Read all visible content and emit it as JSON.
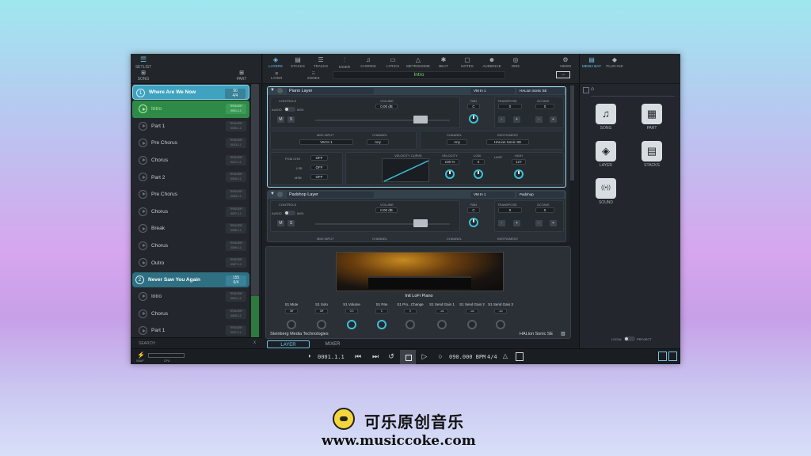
{
  "left_toolbar": {
    "setlist_label": "SETLIST",
    "song_label": "SONG",
    "part_label": "PART"
  },
  "setlist": [
    {
      "type": "song",
      "number": "1",
      "name": "Where Are We Now",
      "trigger_top": "90",
      "trigger_bottom": "4/4"
    },
    {
      "type": "part",
      "name": "Intro",
      "trigger_top": "TRIGGER",
      "trigger_bottom": "0001.1.1",
      "active": true
    },
    {
      "type": "part",
      "name": "Part 1",
      "trigger_top": "TRIGGER",
      "trigger_bottom": "0005.1.1"
    },
    {
      "type": "part",
      "name": "Pre Chorus",
      "trigger_top": "TRIGGER",
      "trigger_bottom": "0013.1.1"
    },
    {
      "type": "part",
      "name": "Chorus",
      "trigger_top": "TRIGGER",
      "trigger_bottom": "0017.1.1"
    },
    {
      "type": "part",
      "name": "Part 2",
      "trigger_top": "TRIGGER",
      "trigger_bottom": "0025.1.1"
    },
    {
      "type": "part",
      "name": "Pre Chorus",
      "trigger_top": "TRIGGER",
      "trigger_bottom": "0033.1.1"
    },
    {
      "type": "part",
      "name": "Chorus",
      "trigger_top": "TRIGGER",
      "trigger_bottom": "0037.1.1"
    },
    {
      "type": "part",
      "name": "Break",
      "trigger_top": "TRIGGER",
      "trigger_bottom": "0045.1.1"
    },
    {
      "type": "part",
      "name": "Chorus",
      "trigger_top": "TRIGGER",
      "trigger_bottom": "0049.1.1"
    },
    {
      "type": "part",
      "name": "Outro",
      "trigger_top": "TRIGGER",
      "trigger_bottom": "0057.1.1"
    },
    {
      "type": "song",
      "number": "2",
      "name": "Never Saw You Again",
      "trigger_top": "155",
      "trigger_bottom": "6/4"
    },
    {
      "type": "part",
      "name": "Intro",
      "trigger_top": "TRIGGER",
      "trigger_bottom": "0001.1.1"
    },
    {
      "type": "part",
      "name": "Chorus",
      "trigger_top": "TRIGGER",
      "trigger_bottom": "0009.1.1"
    },
    {
      "type": "part",
      "name": "Part 1",
      "trigger_top": "TRIGGER",
      "trigger_bottom": "0017.1.1"
    }
  ],
  "search_label": "SEARCH",
  "toolbar": {
    "tools": [
      {
        "label": "LAYERS",
        "icon": "layers-icon",
        "glyph": "◈"
      },
      {
        "label": "STACKS",
        "icon": "stacks-icon",
        "glyph": "▤"
      },
      {
        "label": "TRACKS",
        "icon": "tracks-icon",
        "glyph": "☰"
      },
      {
        "label": "MIXER",
        "icon": "mixer-icon",
        "glyph": "⫶"
      },
      {
        "label": "CHORDS",
        "icon": "chords-icon",
        "glyph": "♫"
      },
      {
        "label": "LYRICS",
        "icon": "lyrics-icon",
        "glyph": "▭"
      },
      {
        "label": "METRONOME",
        "icon": "metronome-icon",
        "glyph": "△"
      },
      {
        "label": "BEAT",
        "icon": "beat-icon",
        "glyph": "✱"
      },
      {
        "label": "NOTES",
        "icon": "notes-icon",
        "glyph": "▢"
      },
      {
        "label": "AUDIENCE",
        "icon": "audience-icon",
        "glyph": "☻"
      },
      {
        "label": "DMX",
        "icon": "dmx-icon",
        "glyph": "◎"
      }
    ],
    "views_label": "VIEWS",
    "layer_label": "LAYER",
    "zones_label": "ZONES",
    "current_part": "Intro"
  },
  "layers": [
    {
      "name": "Piano Layer",
      "midi_in": "VM In 1",
      "instrument": "HALion Sonic SE",
      "controls_label": "CONTROLS",
      "audio_label": "AUDIO",
      "midi_label": "MIDI",
      "volume_label": "VOLUME",
      "volume": "0.00 dB",
      "pan_label": "PAN",
      "pan": "C",
      "transpose_label": "TRANSPOSE",
      "transpose": "0",
      "octave_label": "OCTAVE",
      "octave": "0",
      "m_label": "M",
      "s_label": "S",
      "midi_input_label": "MIDI INPUT",
      "channel_label": "CHANNEL",
      "midi_input_value": "VM In 1",
      "channel_value": "Any",
      "channel2_label": "CHANNEL",
      "instrument_label": "INSTRUMENT",
      "channel2_value": "Any",
      "instrument_value": "HALion Sonic SE",
      "pgm_label": "PGM CHG",
      "pgm_value": "OFF",
      "lsb_label": "LSB",
      "lsb_value": "OFF",
      "msb_label": "MSB",
      "msb_value": "OFF",
      "velocity_curve_label": "VELOCITY CURVE",
      "velocity_label": "VELOCITY",
      "velocity_value": "100 %",
      "low_label": "LOW",
      "low_value": "0",
      "limit_label": "LIMIT",
      "high_label": "HIGH",
      "high_value": "127"
    },
    {
      "name": "Padshop Layer",
      "midi_in": "VM In 1",
      "instrument": "Padshop",
      "controls_label": "CONTROLS",
      "audio_label": "AUDIO",
      "midi_label": "MIDI",
      "volume_label": "VOLUME",
      "volume": "0.00 dB",
      "pan_label": "PAN",
      "pan": "C",
      "transpose_label": "TRANSPOSE",
      "transpose": "0",
      "octave_label": "OCTAVE",
      "octave": "0",
      "m_label": "M",
      "s_label": "S",
      "midi_input_label": "MIDI INPUT",
      "channel_label": "CHANNEL",
      "channel2_label": "CHANNEL",
      "instrument_label": "INSTRUMENT"
    }
  ],
  "plugin": {
    "preset_name": "Init LoFi Piano",
    "vendor": "Steinberg Media Technologies",
    "name": "HALion Sonic SE",
    "params": [
      {
        "label": "S1 Mute",
        "value": "Off"
      },
      {
        "label": "S1 Solo",
        "value": "Off"
      },
      {
        "label": "S1 Volume",
        "value": "0.0"
      },
      {
        "label": "S1 Pan",
        "value": "C"
      },
      {
        "label": "S1 Pro...Change",
        "value": "0"
      },
      {
        "label": "S1 Send Gain 1",
        "value": "-oo"
      },
      {
        "label": "S1 Send Gain 2",
        "value": "-oo"
      },
      {
        "label": "S1 Send Gain 3",
        "value": "-oo"
      }
    ],
    "tab_layer": "LAYER",
    "tab_mixer": "MIXER"
  },
  "media_bay": {
    "tab_media": "MEDIA BAY",
    "tab_plugins": "PLUG-INS",
    "items": [
      {
        "label": "SONG",
        "icon": "song-icon",
        "glyph": "♫"
      },
      {
        "label": "PART",
        "icon": "part-icon",
        "glyph": "▦"
      },
      {
        "label": "LAYER",
        "icon": "layer-icon",
        "glyph": "◈"
      },
      {
        "label": "STACKS",
        "icon": "stacks-icon",
        "glyph": "▤"
      },
      {
        "label": "SOUND",
        "icon": "sound-icon",
        "glyph": "((•))"
      }
    ],
    "local_label": "LOCAL",
    "project_label": "PROJECT"
  },
  "transport": {
    "snap_label": "SNAP",
    "cpu_label": "CPU",
    "position": "0001.1.1",
    "tempo": "090.000 BPM",
    "signature": "4/4"
  },
  "watermark": {
    "title": "可乐原创音乐",
    "url": "www.musiccoke.com"
  },
  "colors": {
    "accent_blue": "#6fc3e6",
    "active_green": "#2f8a47",
    "song_teal": "#2e6f82",
    "panel_bg": "#1b1f24"
  }
}
